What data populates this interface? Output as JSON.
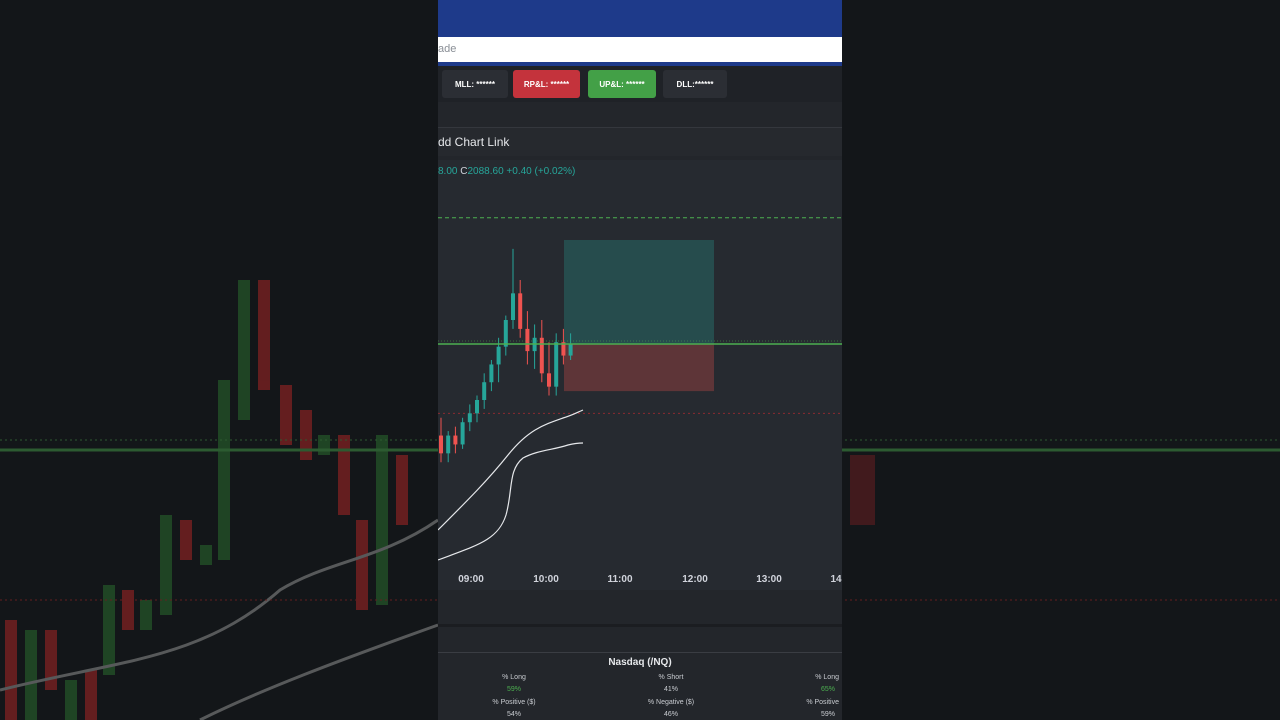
{
  "search": {
    "text": "ade"
  },
  "badges": {
    "mll": "MLL: ******",
    "rpl": "RP&L: ******",
    "upl": "UP&L: ******",
    "dll": "DLL:******"
  },
  "chart_header": {
    "label": "dd Chart Link"
  },
  "ohlc": {
    "prev": "8.00",
    "c_label": "C",
    "close": "2088.60",
    "change": "+0.40 (+0.02%)"
  },
  "chart_data": {
    "type": "candlestick",
    "x_ticks": [
      "09:00",
      "10:00",
      "11:00",
      "12:00",
      "13:00",
      "14"
    ],
    "candles": [
      {
        "o": 2068,
        "h": 2072,
        "l": 2062,
        "c": 2064
      },
      {
        "o": 2064,
        "h": 2069,
        "l": 2062,
        "c": 2068
      },
      {
        "o": 2068,
        "h": 2070,
        "l": 2064,
        "c": 2066
      },
      {
        "o": 2066,
        "h": 2072,
        "l": 2065,
        "c": 2071
      },
      {
        "o": 2071,
        "h": 2075,
        "l": 2069,
        "c": 2073
      },
      {
        "o": 2073,
        "h": 2077,
        "l": 2071,
        "c": 2076
      },
      {
        "o": 2076,
        "h": 2082,
        "l": 2074,
        "c": 2080
      },
      {
        "o": 2080,
        "h": 2085,
        "l": 2078,
        "c": 2084
      },
      {
        "o": 2084,
        "h": 2090,
        "l": 2080,
        "c": 2088
      },
      {
        "o": 2088,
        "h": 2095,
        "l": 2086,
        "c": 2094
      },
      {
        "o": 2094,
        "h": 2110,
        "l": 2092,
        "c": 2100
      },
      {
        "o": 2100,
        "h": 2103,
        "l": 2090,
        "c": 2092
      },
      {
        "o": 2092,
        "h": 2096,
        "l": 2084,
        "c": 2087
      },
      {
        "o": 2087,
        "h": 2093,
        "l": 2083,
        "c": 2090
      },
      {
        "o": 2090,
        "h": 2094,
        "l": 2080,
        "c": 2082
      },
      {
        "o": 2082,
        "h": 2089,
        "l": 2077,
        "c": 2079
      },
      {
        "o": 2079,
        "h": 2091,
        "l": 2077,
        "c": 2089
      },
      {
        "o": 2089,
        "h": 2092,
        "l": 2084,
        "c": 2086
      },
      {
        "o": 2086,
        "h": 2091,
        "l": 2085,
        "c": 2088.6
      }
    ],
    "entry_price": 2088.6,
    "target_price": 2117,
    "stop_price": 2078
  },
  "stats": {
    "title": "Nasdaq (/NQ)",
    "items": [
      {
        "label": "% Long",
        "value": "59%"
      },
      {
        "label": "% Positive ($)",
        "value": "54%"
      },
      {
        "label": "% Short",
        "value": "41%"
      },
      {
        "label": "% Negative ($)",
        "value": "46%"
      },
      {
        "label": "% Long",
        "value": "65%"
      },
      {
        "label": "% Positive",
        "value": "59%"
      }
    ]
  },
  "colors": {
    "up": "#26a69a",
    "down": "#ef5350",
    "line": "#4caf50"
  }
}
